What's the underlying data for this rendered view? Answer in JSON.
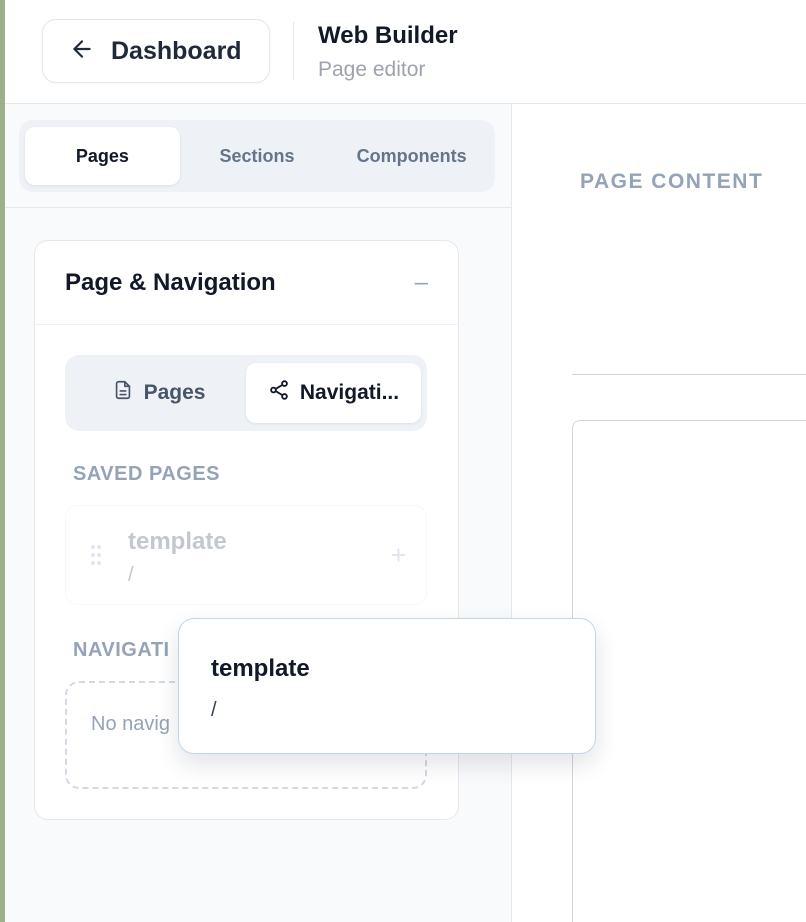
{
  "header": {
    "back_label": "Dashboard",
    "app_title": "Web Builder",
    "app_subtitle": "Page editor"
  },
  "sidebar": {
    "tabs": [
      {
        "label": "Pages",
        "active": true
      },
      {
        "label": "Sections",
        "active": false
      },
      {
        "label": "Components",
        "active": false
      }
    ],
    "panel": {
      "title": "Page & Navigation",
      "collapse_symbol": "–",
      "subtabs": [
        {
          "label": "Pages",
          "icon": "document-icon",
          "active": false
        },
        {
          "label": "Navigati...",
          "icon": "share-icon",
          "active": true
        }
      ],
      "saved_pages_label": "SAVED PAGES",
      "saved_pages": [
        {
          "title": "template",
          "path": "/"
        }
      ],
      "navigation_label": "NAVIGATI",
      "navigation_empty": "No navig"
    }
  },
  "main": {
    "page_content_label": "PAGE CONTENT"
  },
  "drag_ghost": {
    "title": "template",
    "path": "/"
  },
  "colors": {
    "accent_border": "#bfd7ee",
    "muted_text": "#94a3b8",
    "left_edge": "#9db08a"
  }
}
